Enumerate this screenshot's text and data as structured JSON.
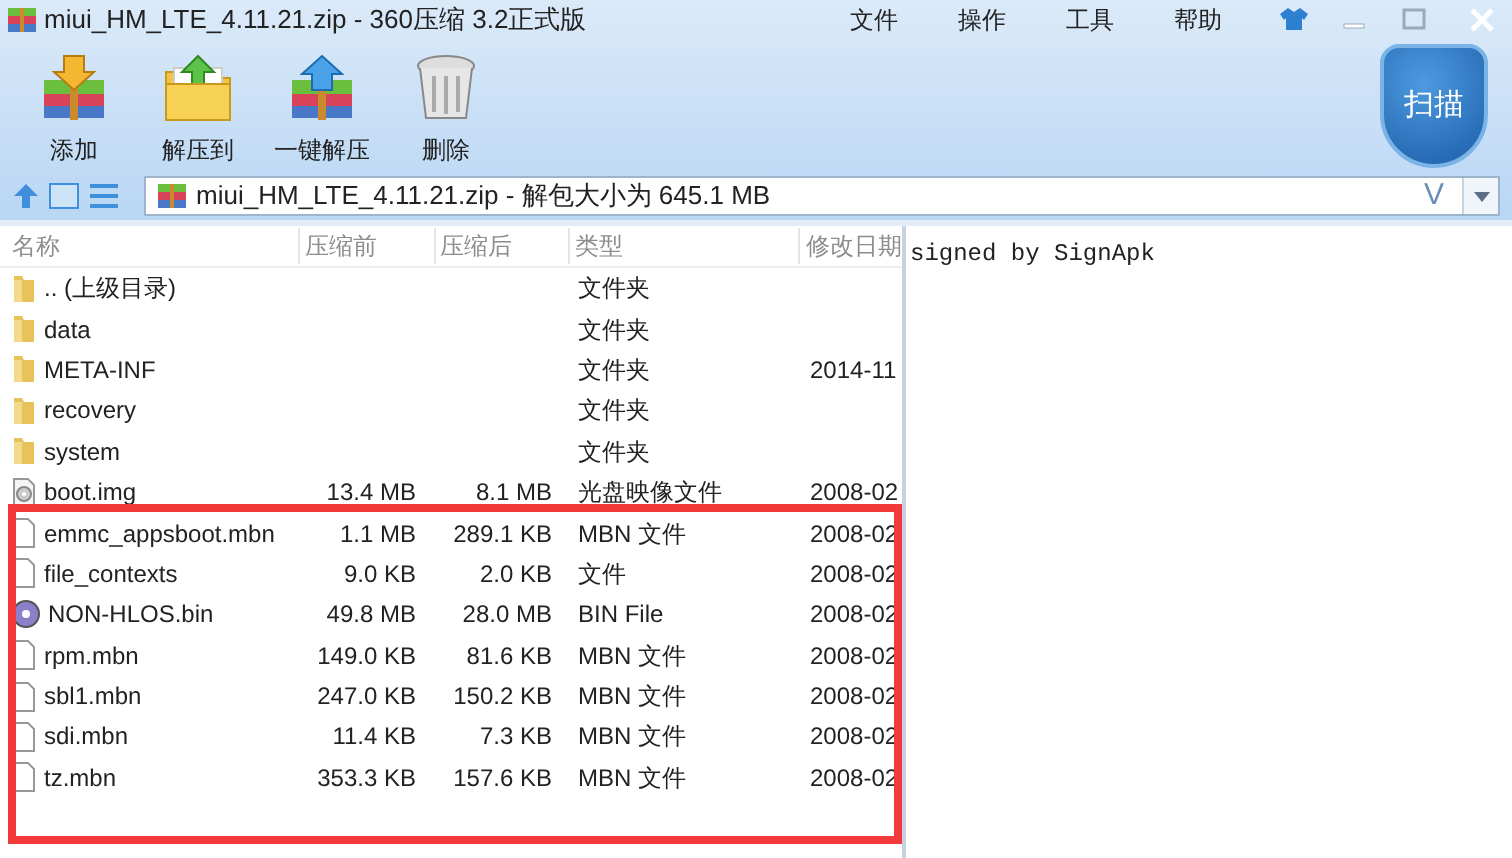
{
  "window": {
    "title": "miui_HM_LTE_4.11.21.zip - 360压缩 3.2正式版"
  },
  "menu": [
    "文件",
    "操作",
    "工具",
    "帮助"
  ],
  "toolbar": [
    {
      "label": "添加",
      "kind": "add"
    },
    {
      "label": "解压到",
      "kind": "extract"
    },
    {
      "label": "一键解压",
      "kind": "oneclick"
    },
    {
      "label": "删除",
      "kind": "delete"
    }
  ],
  "scan_button": {
    "label": "扫描"
  },
  "address": {
    "value": "miui_HM_LTE_4.11.21.zip - 解包大小为 645.1 MB",
    "shortcut": "V"
  },
  "table": {
    "columns": [
      "名称",
      "压缩前",
      "压缩后",
      "类型",
      "修改日期"
    ],
    "rows": [
      {
        "kind": "folder",
        "name": ".. (上级目录)",
        "size": "",
        "packed": "",
        "type": "文件夹",
        "date": ""
      },
      {
        "kind": "folder",
        "name": "data",
        "size": "",
        "packed": "",
        "type": "文件夹",
        "date": ""
      },
      {
        "kind": "folder",
        "name": "META-INF",
        "size": "",
        "packed": "",
        "type": "文件夹",
        "date": "2014-11"
      },
      {
        "kind": "folder",
        "name": "recovery",
        "size": "",
        "packed": "",
        "type": "文件夹",
        "date": ""
      },
      {
        "kind": "folder",
        "name": "system",
        "size": "",
        "packed": "",
        "type": "文件夹",
        "date": ""
      },
      {
        "kind": "image",
        "name": "boot.img",
        "size": "13.4 MB",
        "packed": "8.1 MB",
        "type": "光盘映像文件",
        "date": "2008-02"
      },
      {
        "kind": "file",
        "name": "emmc_appsboot.mbn",
        "size": "1.1 MB",
        "packed": "289.1 KB",
        "type": "MBN 文件",
        "date": "2008-02"
      },
      {
        "kind": "file",
        "name": "file_contexts",
        "size": "9.0 KB",
        "packed": "2.0 KB",
        "type": "文件",
        "date": "2008-02"
      },
      {
        "kind": "bin",
        "name": "NON-HLOS.bin",
        "size": "49.8 MB",
        "packed": "28.0 MB",
        "type": "BIN File",
        "date": "2008-02"
      },
      {
        "kind": "file",
        "name": "rpm.mbn",
        "size": "149.0 KB",
        "packed": "81.6 KB",
        "type": "MBN 文件",
        "date": "2008-02"
      },
      {
        "kind": "file",
        "name": "sbl1.mbn",
        "size": "247.0 KB",
        "packed": "150.2 KB",
        "type": "MBN 文件",
        "date": "2008-02"
      },
      {
        "kind": "file",
        "name": "sdi.mbn",
        "size": "11.4 KB",
        "packed": "7.3 KB",
        "type": "MBN 文件",
        "date": "2008-02"
      },
      {
        "kind": "file",
        "name": "tz.mbn",
        "size": "353.3 KB",
        "packed": "157.6 KB",
        "type": "MBN 文件",
        "date": "2008-02"
      }
    ]
  },
  "comment": "signed by SignApk",
  "highlight": {
    "color": "#f23a3a"
  }
}
